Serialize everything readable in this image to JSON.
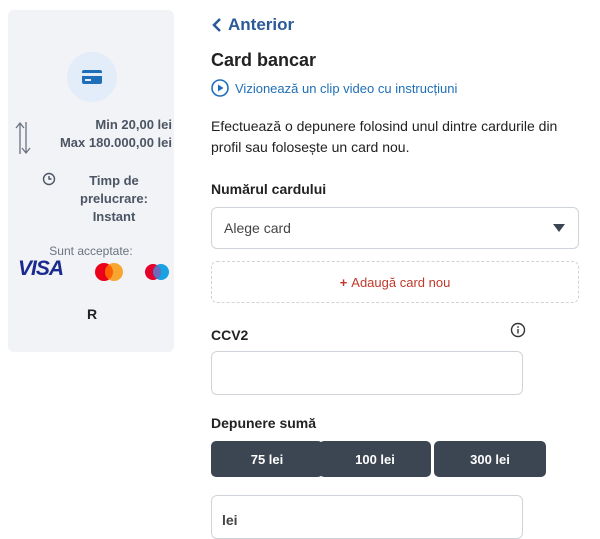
{
  "sidebar": {
    "min_limit": "Min 20,00 lei",
    "max_limit": "Max 180.000,00 lei",
    "processing_time": "Timp de prelucrare: Instant",
    "accepted_label": "Sunt acceptate:",
    "brands": {
      "visa": "VISA",
      "revolut": "R"
    }
  },
  "nav": {
    "back_label": "Anterior"
  },
  "main": {
    "title": "Card bancar",
    "video_link": "Vizionează un clip video cu instrucțiuni",
    "description": "Efectuează o depunere folosind unul dintre cardurile din profil sau folosește un card nou."
  },
  "card_number": {
    "label": "Numărul cardului",
    "select_value": "Alege card",
    "add_card": "Adaugă card nou"
  },
  "ccv": {
    "label": "CCV2",
    "value": ""
  },
  "deposit": {
    "label": "Depunere sumă",
    "quick_amounts": [
      "75 lei",
      "100 lei",
      "300 lei"
    ],
    "currency": "lei"
  },
  "colors": {
    "accent_blue": "#2a5a98",
    "link_blue": "#1e6fb8",
    "add_red": "#c0392b",
    "dark_button": "#3c4552",
    "panel_bg": "#f1f3f6"
  }
}
